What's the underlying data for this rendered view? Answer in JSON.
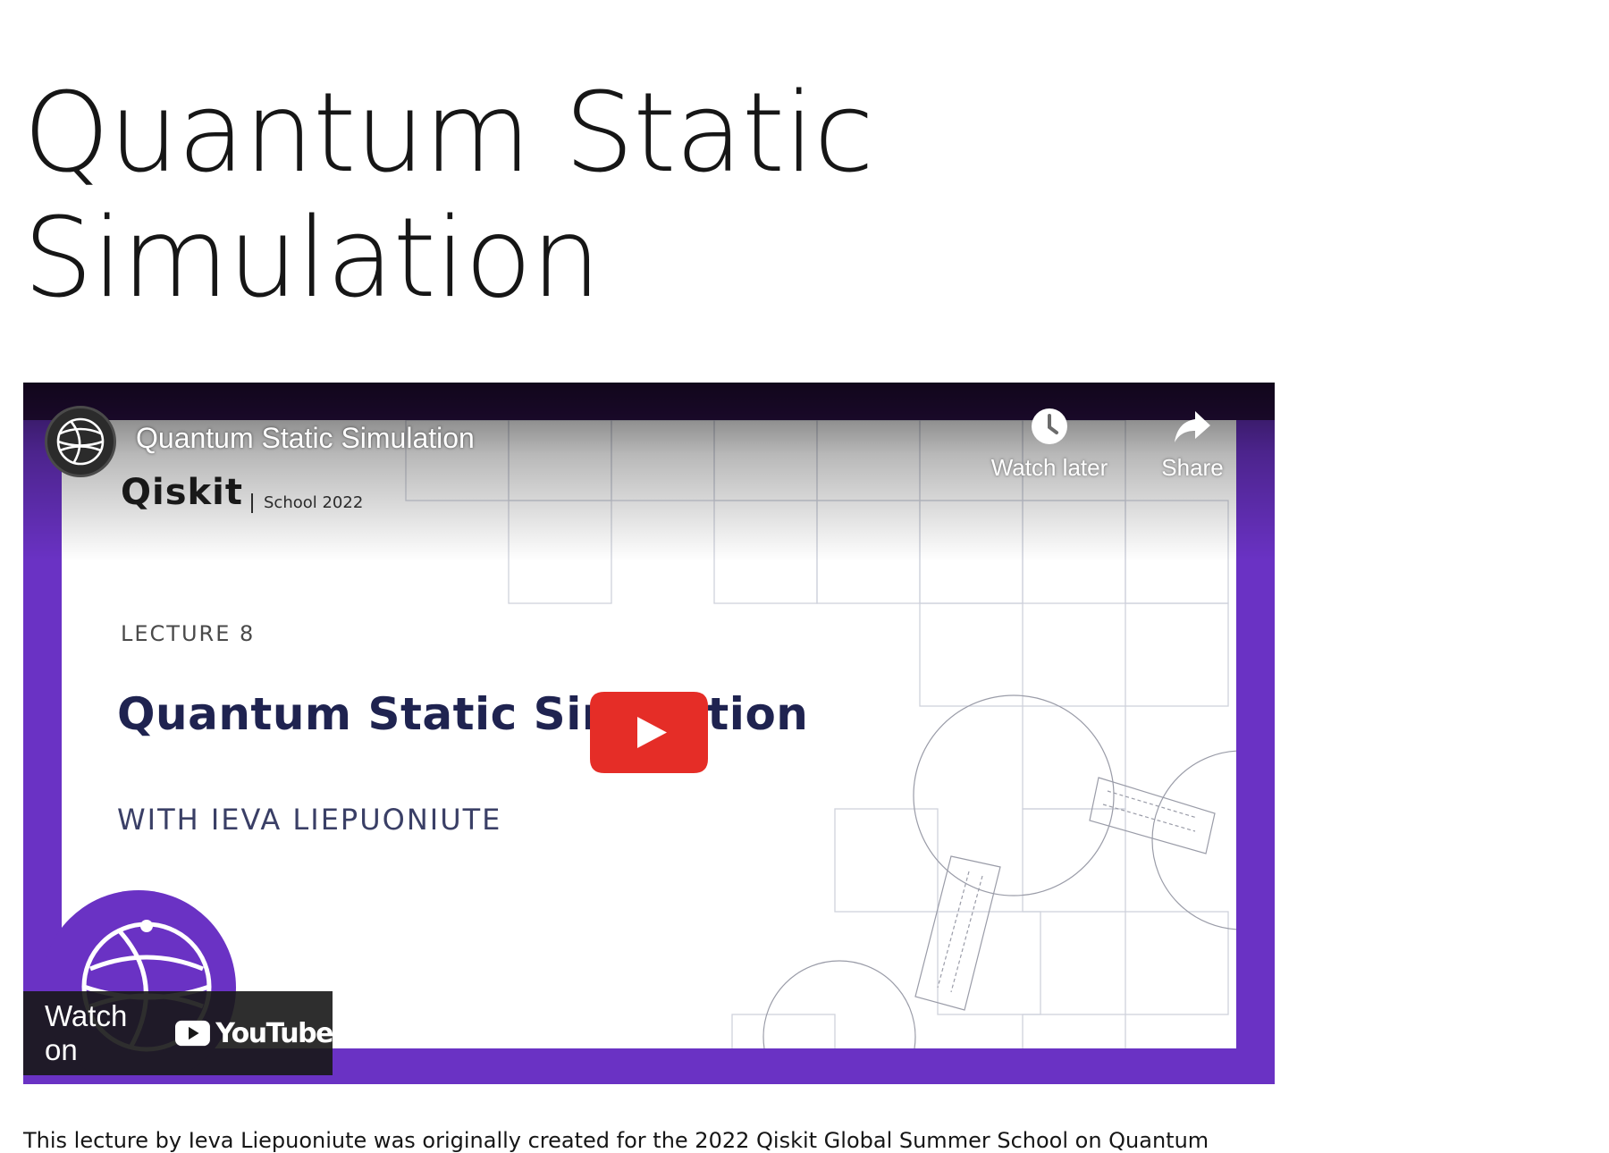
{
  "page": {
    "title": "Quantum Static Simulation"
  },
  "video": {
    "title": "Quantum Static Simulation",
    "channel_avatar_icon": "qiskit-globe-icon",
    "watch_later_label": "Watch later",
    "share_label": "Share",
    "watch_on_label": "Watch on",
    "youtube_wordmark": "YouTube",
    "thumbnail": {
      "brand": "Qiskit",
      "school": "School 2022",
      "lecture": "LECTURE 8",
      "slide_title": "Quantum Static Simulation",
      "presenter": "WITH IEVA LIEPUONIUTE"
    },
    "colors": {
      "frame_purple": "#6a32c4",
      "top_band": "#2d1048",
      "play_red": "#e52d27",
      "slide_title_navy": "#1f2350"
    }
  },
  "description": {
    "text": "This lecture by Ieva Liepuoniute was originally created for the 2022 Qiskit Global Summer School on Quantum"
  }
}
